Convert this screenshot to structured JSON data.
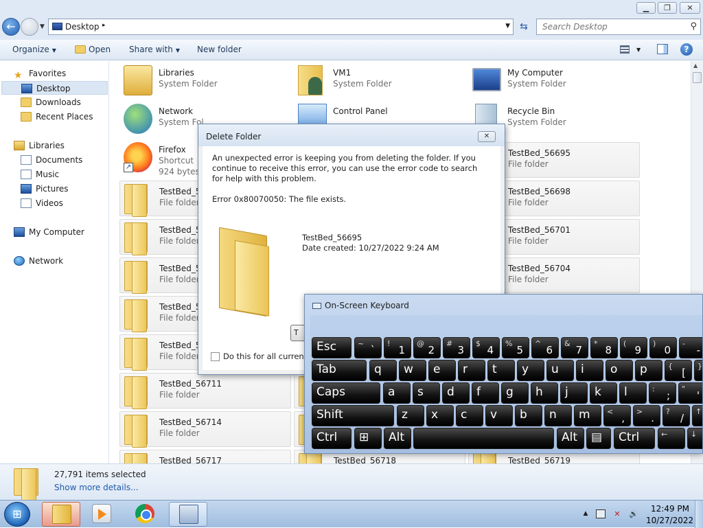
{
  "window": {
    "caption_min": "▁",
    "caption_max": "❐",
    "caption_close": "✕"
  },
  "address": {
    "path": "Desktop",
    "separator": "▸",
    "search_placeholder": "Search Desktop"
  },
  "toolbar": {
    "organize": "Organize",
    "open": "Open",
    "share_with": "Share with",
    "new_folder": "New folder",
    "help": "?"
  },
  "navpane": {
    "favorites": "Favorites",
    "desktop": "Desktop",
    "downloads": "Downloads",
    "recent_places": "Recent Places",
    "libraries": "Libraries",
    "documents": "Documents",
    "music": "Music",
    "pictures": "Pictures",
    "videos": "Videos",
    "my_computer": "My Computer",
    "network": "Network"
  },
  "items": {
    "libraries": {
      "name": "Libraries",
      "type": "System Folder"
    },
    "vm1": {
      "name": "VM1",
      "type": "System Folder"
    },
    "my_computer": {
      "name": "My Computer",
      "type": "System Folder"
    },
    "network": {
      "name": "Network",
      "type": "System Fol"
    },
    "control_panel": {
      "name": "Control Panel"
    },
    "recycle_bin": {
      "name": "Recycle Bin",
      "type": "System Folder"
    },
    "firefox": {
      "name": "Firefox",
      "type": "Shortcut",
      "size": "924 bytes"
    },
    "tb_56695": {
      "name": "TestBed_56695",
      "type": "File folder"
    },
    "tb_56698": {
      "name": "TestBed_56698",
      "type": "File folder"
    },
    "tb_56701": {
      "name": "TestBed_56701",
      "type": "File folder"
    },
    "tb_56704": {
      "name": "TestBed_56704",
      "type": "File folder"
    },
    "left_1": {
      "name": "TestBed_56",
      "type": "File folder"
    },
    "left_2": {
      "name": "TestBed_56",
      "type": "File folder"
    },
    "left_3": {
      "name": "TestBed_56",
      "type": "File folder"
    },
    "left_4": {
      "name": "TestBed_56",
      "type": "File folder"
    },
    "left_5": {
      "name": "TestBed_56",
      "type": "File folder"
    },
    "tb_56711": {
      "name": "TestBed_56711",
      "type": "File folder"
    },
    "tb_56714": {
      "name": "TestBed_56714",
      "type": "File folder"
    },
    "tb_56717": {
      "name": "TestBed_56717"
    },
    "tb_56718": {
      "name": "TestBed_56718"
    },
    "tb_56719": {
      "name": "TestBed_56719"
    }
  },
  "details": {
    "count": "27,791 items selected",
    "more": "Show more details..."
  },
  "dialog": {
    "title": "Delete Folder",
    "close": "✕",
    "message": "An unexpected error is keeping you from deleting the folder. If you continue to receive this error, you can use the error code to search for help with this problem.",
    "error": "Error 0x80070050: The file exists.",
    "folder_name": "TestBed_56695",
    "folder_date": "Date created: 10/27/2022 9:24 AM",
    "button_partial": "T",
    "checkbox_label": "Do this for all current it"
  },
  "osk": {
    "title": "On-Screen Keyboard",
    "keys": {
      "esc": "Esc",
      "tilde_s": "~",
      "tilde_m": "`",
      "n1_s": "!",
      "n1_m": "1",
      "n2_s": "@",
      "n2_m": "2",
      "n3_s": "#",
      "n3_m": "3",
      "n4_s": "$",
      "n4_m": "4",
      "n5_s": "%",
      "n5_m": "5",
      "n6_s": "^",
      "n6_m": "6",
      "n7_s": "&",
      "n7_m": "7",
      "n8_s": "*",
      "n8_m": "8",
      "n9_s": "(",
      "n9_m": "9",
      "n0_s": ")",
      "n0_m": "0",
      "minus_s": "-",
      "minus_m": "-",
      "tab": "Tab",
      "q": "q",
      "w": "w",
      "e": "e",
      "r": "r",
      "t": "t",
      "y": "y",
      "u": "u",
      "i": "i",
      "o": "o",
      "p": "p",
      "lbr_s": "{",
      "lbr_m": "[",
      "rbr_s": "}",
      "rbr_m": "]",
      "caps": "Caps",
      "a": "a",
      "s": "s",
      "d": "d",
      "f": "f",
      "g": "g",
      "h": "h",
      "j": "j",
      "k": "k",
      "l": "l",
      "semi_s": ":",
      "semi_m": ";",
      "quote_s": "\"",
      "quote_m": "'",
      "shift": "Shift",
      "z": "z",
      "x": "x",
      "c": "c",
      "v": "v",
      "b": "b",
      "n": "n",
      "m": "m",
      "comma_s": "<",
      "comma_m": ",",
      "period_s": ">",
      "period_m": ".",
      "slash_s": "?",
      "slash_m": "/",
      "up": "↑",
      "ctrl": "Ctrl",
      "win": "⊞",
      "alt": "Alt",
      "alt_r": "Alt",
      "menu": "▤",
      "ctrl_r": "Ctrl",
      "left": "←",
      "down": "↓"
    }
  },
  "taskbar": {
    "start": "⊞",
    "tray_arrow": "▲",
    "volume": "🔊",
    "flag": "✕",
    "time": "12:49 PM",
    "date": "10/27/2022"
  }
}
